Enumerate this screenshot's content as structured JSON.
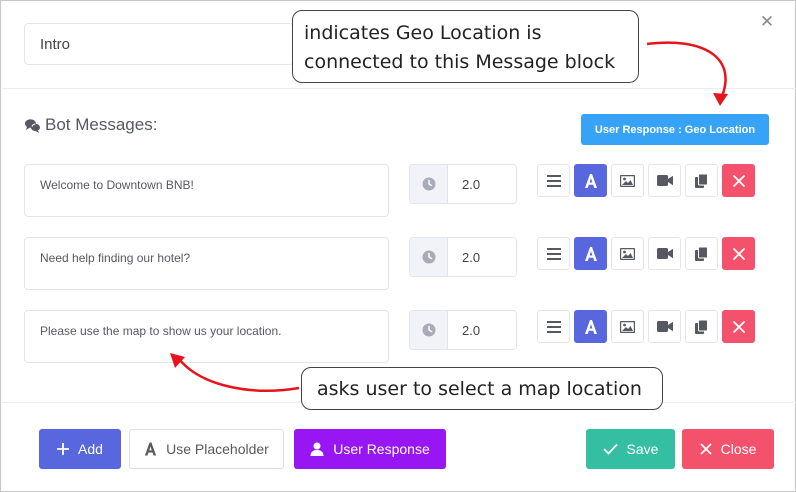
{
  "header": {
    "title_value": "Intro"
  },
  "section": {
    "title": "Bot Messages:"
  },
  "geo_badge": {
    "label": "User Response : Geo Location"
  },
  "messages": [
    {
      "text": "Welcome to Downtown BNB!",
      "delay": "2.0"
    },
    {
      "text": "Need help finding our hotel?",
      "delay": "2.0"
    },
    {
      "text": "Please use the map to show us your location.",
      "delay": "2.0"
    }
  ],
  "callouts": {
    "top": "indicates Geo Location is connected to this Message block",
    "bottom": "asks user to select a map location"
  },
  "footer": {
    "add": "Add",
    "placeholder": "Use Placeholder",
    "user_response": "User Response",
    "save": "Save",
    "close": "Close"
  },
  "colors": {
    "primary": "#5867dd",
    "info": "#36a3f7",
    "purple": "#9816f4",
    "success": "#34bfa3",
    "danger": "#f4516c",
    "annotation_arrow": "#e8141c"
  }
}
